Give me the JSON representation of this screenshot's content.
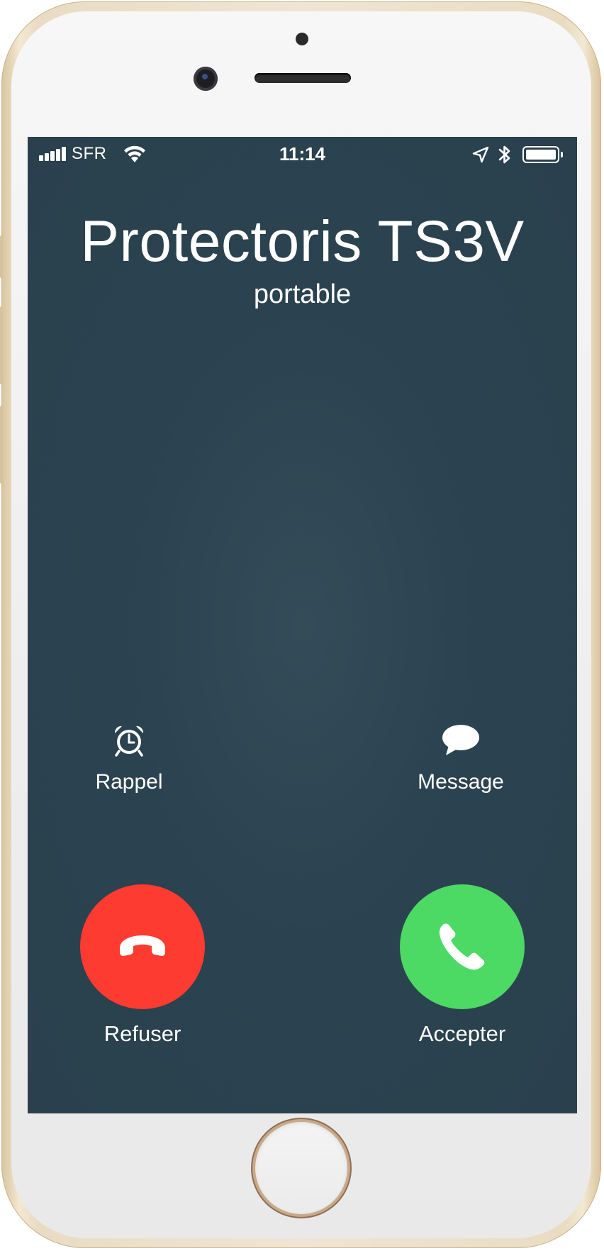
{
  "status_bar": {
    "carrier": "SFR",
    "time": "11:14",
    "signal_icon": "signal-bars-icon",
    "wifi_icon": "wifi-icon",
    "location_icon": "location-arrow-icon",
    "bluetooth_icon": "bluetooth-icon",
    "battery_icon": "battery-icon",
    "battery_level": 1.0
  },
  "caller": {
    "name": "Protectoris TS3V",
    "subtitle": "portable"
  },
  "options": {
    "remind_label": "Rappel",
    "remind_icon": "alarm-clock-icon",
    "message_label": "Message",
    "message_icon": "speech-bubble-icon"
  },
  "actions": {
    "decline_label": "Refuser",
    "decline_color": "#fd3b30",
    "decline_icon": "hang-up-phone-icon",
    "accept_label": "Accepter",
    "accept_color": "#4cd964",
    "accept_icon": "phone-icon"
  },
  "colors": {
    "screen_background": "#2b4350",
    "device_frame": "#e9dcc3"
  }
}
